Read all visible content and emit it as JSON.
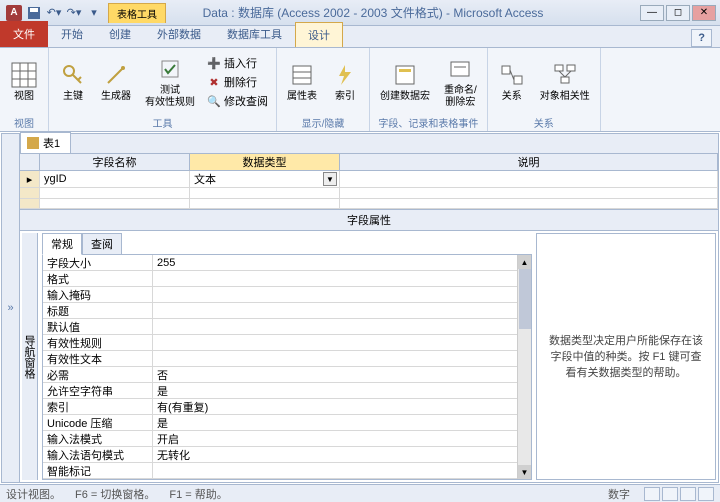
{
  "titlebar": {
    "app_letter": "A",
    "context_tab": "表格工具",
    "title": "Data : 数据库 (Access 2002 - 2003 文件格式) - Microsoft Access"
  },
  "tabs": {
    "file": "文件",
    "items": [
      "开始",
      "创建",
      "外部数据",
      "数据库工具",
      "设计"
    ]
  },
  "ribbon": {
    "group_view": "视图",
    "view_btn": "视图",
    "group_tools": "工具",
    "pk_btn": "主键",
    "builder_btn": "生成器",
    "test_btn": "测试\n有效性规则",
    "insert_row": "插入行",
    "delete_row": "删除行",
    "modify_lookup": "修改查阅",
    "group_showhide": "显示/隐藏",
    "prop_sheet": "属性表",
    "index_btn": "索引",
    "group_events": "字段、记录和表格事件",
    "create_macro": "创建数据宏",
    "rename_delete": "重命名/\n删除宏",
    "group_rel": "关系",
    "rel_btn": "关系",
    "obj_dep": "对象相关性"
  },
  "doc": {
    "tab_name": "表1",
    "col_field": "字段名称",
    "col_type": "数据类型",
    "col_desc": "说明",
    "row1_name": "ygID",
    "row1_type": "文本",
    "field_props_label": "字段属性"
  },
  "prop_tabs": {
    "general": "常规",
    "lookup": "查阅"
  },
  "props": [
    {
      "n": "字段大小",
      "v": "255"
    },
    {
      "n": "格式",
      "v": ""
    },
    {
      "n": "输入掩码",
      "v": ""
    },
    {
      "n": "标题",
      "v": ""
    },
    {
      "n": "默认值",
      "v": ""
    },
    {
      "n": "有效性规则",
      "v": ""
    },
    {
      "n": "有效性文本",
      "v": ""
    },
    {
      "n": "必需",
      "v": "否"
    },
    {
      "n": "允许空字符串",
      "v": "是"
    },
    {
      "n": "索引",
      "v": "有(有重复)"
    },
    {
      "n": "Unicode 压缩",
      "v": "是"
    },
    {
      "n": "输入法模式",
      "v": "开启"
    },
    {
      "n": "输入法语句模式",
      "v": "无转化"
    },
    {
      "n": "智能标记",
      "v": ""
    }
  ],
  "help_text": "数据类型决定用户所能保存在该字段中值的种类。按 F1 键可查看有关数据类型的帮助。",
  "side_label": "导航窗格",
  "status": {
    "view": "设计视图。",
    "f6": "F6 = 切换窗格。",
    "f1": "F1 = 帮助。",
    "mode": "数字"
  }
}
